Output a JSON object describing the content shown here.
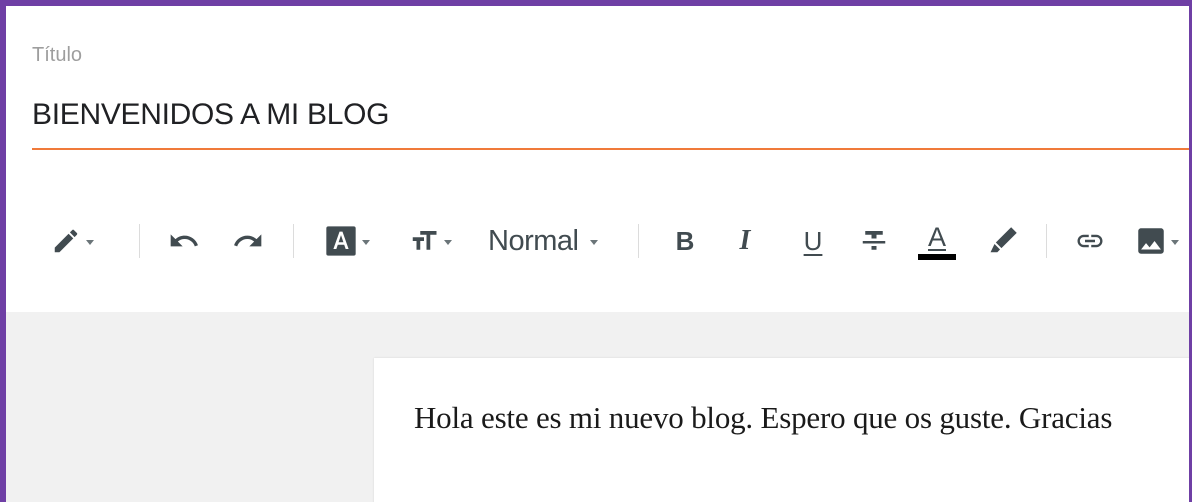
{
  "title_field": {
    "label": "Título",
    "value": "BIENVENIDOS A MI BLOG"
  },
  "toolbar": {
    "pencil_icon": "pencil-icon",
    "undo_icon": "undo-icon",
    "redo_icon": "redo-icon",
    "font_icon": "font-icon",
    "text_size_icon": "text-size-icon",
    "format_label": "Normal",
    "bold_label": "B",
    "italic_label": "I",
    "underline_label": "U",
    "text_color_label": "A",
    "text_color_value": "#000000",
    "highlight_icon": "highlighter-icon",
    "link_icon": "link-icon",
    "image_icon": "image-icon"
  },
  "editor": {
    "body_text": "Hola este es mi nuevo blog. Espero que os guste. Gracias"
  },
  "colors": {
    "frame": "#6f3fa5",
    "title_underline": "#f07a3a",
    "icon": "#414b50",
    "canvas_background": "#f1f1f1"
  }
}
